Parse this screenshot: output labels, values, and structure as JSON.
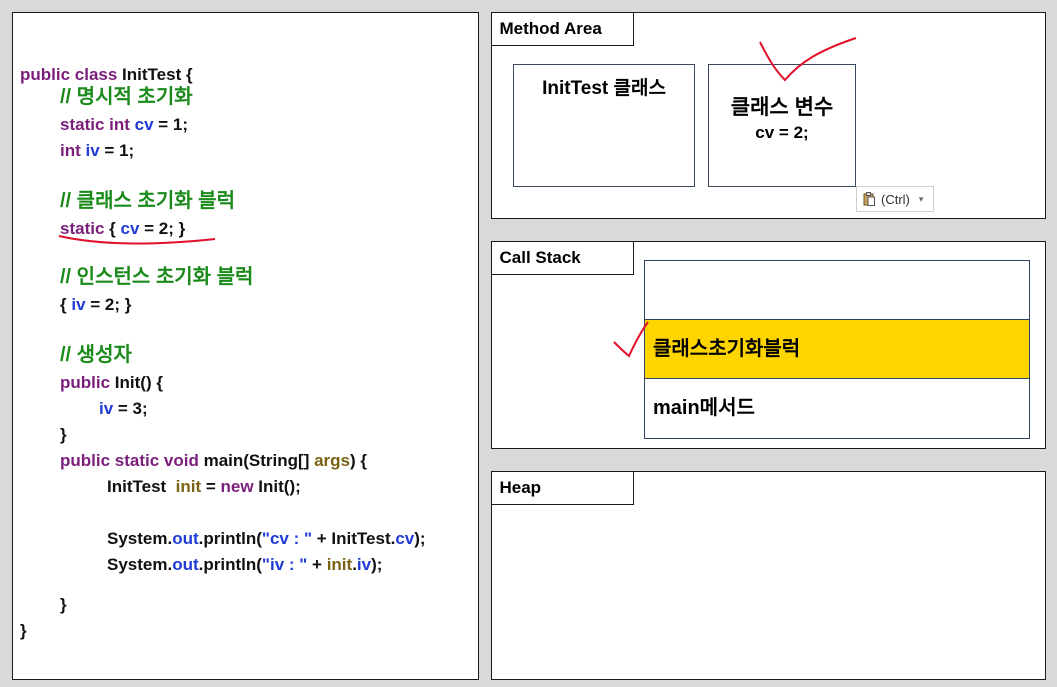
{
  "code": {
    "line1_kw": "public class",
    "line1_rest": " InitTest {",
    "comment_explicit": "// 명시적 초기화",
    "static_int_kw": "static int",
    "cv": "cv",
    "eq_1": " = 1;",
    "int_kw": "int",
    "iv": "iv",
    "comment_class_block": "// 클래스 초기화 블럭",
    "static_kw": "static",
    "brace_open": " { ",
    "eq_2_close": " = 2; }",
    "comment_instance_block": "// 인스턴스 초기화 블럭",
    "brace_open_plain": "{ ",
    "eq_2_close_iv": " = 2; }",
    "comment_constructor": "// 생성자",
    "public_kw": "public",
    "init_decl": " Init() {",
    "eq_3": " = 3;",
    "close_brace": "}",
    "public_static_void_kw": "public static void",
    "main_decl": " main(String[] ",
    "args": "args",
    "main_tail": ") {",
    "inittest_type": "InitTest  ",
    "init_var": "init",
    "eq": " = ",
    "new_kw": "new",
    "init_call": " Init();",
    "system": "System.",
    "out": "out",
    "println_open": ".println(",
    "str_cv": "\"cv : \"",
    "plus_inittest": " + InitTest.",
    "close_paren": ");",
    "str_iv": "\"iv : \"",
    "plus": " + ",
    "dot": ".",
    "outer_close": "}"
  },
  "method_area": {
    "label": "Method Area",
    "class_box_title": "InitTest 클래스",
    "class_var_title": "클래스 변수",
    "class_var_value": "cv = 2;"
  },
  "call_stack": {
    "label": "Call Stack",
    "rows": [
      "",
      "클래스초기화블럭",
      "main메서드"
    ],
    "highlight_color": "#ffd500"
  },
  "heap": {
    "label": "Heap"
  },
  "paste_options": {
    "label": "(Ctrl)",
    "icon": "clipboard-icon"
  },
  "colors": {
    "keyword": "#7b1f7b",
    "variable": "#1f3bd4",
    "comment": "#1a8a1a",
    "annotation": "#e0102a"
  }
}
